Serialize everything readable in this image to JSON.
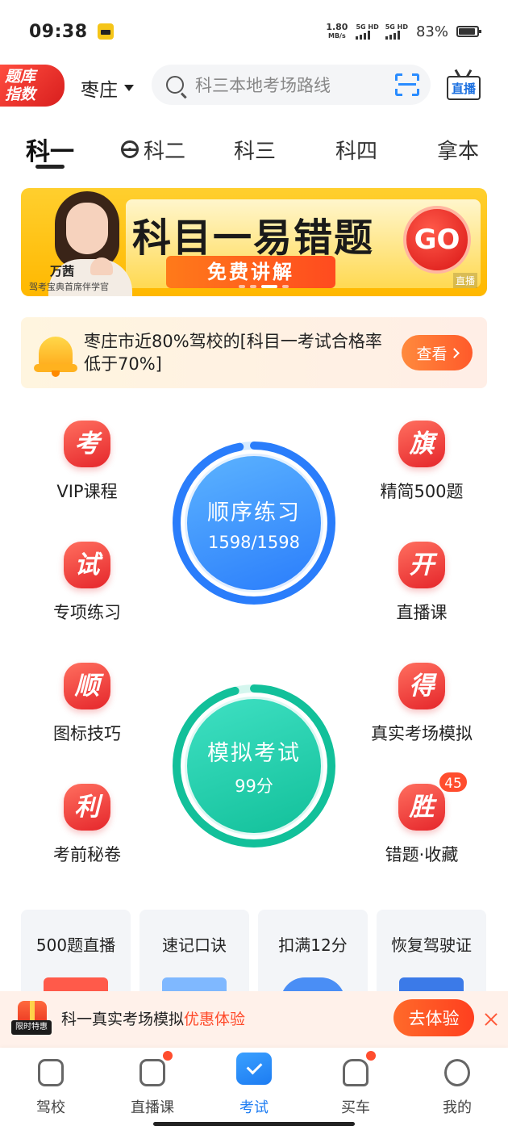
{
  "status_bar": {
    "time": "09:38",
    "net_speed_value": "1.80",
    "net_speed_unit": "MB/s",
    "sim1_label": "5G HD",
    "sim2_label": "5G HD",
    "battery_pct": "83%"
  },
  "header": {
    "badge_line1": "题库",
    "badge_line2": "指数",
    "city": "枣庄",
    "search_placeholder": "科三本地考场路线",
    "live_label": "直播"
  },
  "tabs": [
    {
      "label": "科一",
      "active": true
    },
    {
      "label": "科二",
      "active": false
    },
    {
      "label": "科三",
      "active": false
    },
    {
      "label": "科四",
      "active": false
    },
    {
      "label": "拿本",
      "active": false
    }
  ],
  "banner": {
    "title": "科目一易错题",
    "subtitle": "免费讲解",
    "go_label": "GO",
    "teacher_name": "万茜",
    "teacher_title": "驾考宝典首席伴学官",
    "live_tag": "直播"
  },
  "notice": {
    "text": "枣庄市近80%驾校的[科目一考试合格率低于70%]",
    "button": "查看"
  },
  "features_left": [
    {
      "icon_char": "考",
      "label": "VIP课程"
    },
    {
      "icon_char": "试",
      "label": "专项练习"
    },
    {
      "icon_char": "顺",
      "label": "图标技巧"
    },
    {
      "icon_char": "利",
      "label": "考前秘卷"
    }
  ],
  "features_right": [
    {
      "icon_char": "旗",
      "label": "精简500题"
    },
    {
      "icon_char": "开",
      "label": "直播课"
    },
    {
      "icon_char": "得",
      "label": "真实考场模拟"
    },
    {
      "icon_char": "胜",
      "label": "错题·收藏",
      "badge": "45"
    }
  ],
  "practice": {
    "title": "顺序练习",
    "value": "1598/1598",
    "progress": 1.0,
    "color": "#2a7dfb"
  },
  "exam": {
    "title": "模拟考试",
    "value": "99分",
    "progress": 0.99,
    "color": "#12c09a"
  },
  "shortcuts": [
    {
      "label": "500题直播"
    },
    {
      "label": "速记口诀"
    },
    {
      "label": "扣满12分"
    },
    {
      "label": "恢复驾驶证"
    }
  ],
  "promo": {
    "tag": "限时特惠",
    "text_main": "科一真实考场模拟",
    "text_highlight": "优惠体验",
    "button": "去体验"
  },
  "bottom_nav": [
    {
      "label": "驾校",
      "icon": "school-icon",
      "active": false,
      "dot": false
    },
    {
      "label": "直播课",
      "icon": "live-tv-icon",
      "active": false,
      "dot": true
    },
    {
      "label": "考试",
      "icon": "exam-folder-icon",
      "active": true,
      "dot": false
    },
    {
      "label": "买车",
      "icon": "car-icon",
      "active": false,
      "dot": true
    },
    {
      "label": "我的",
      "icon": "profile-smile-icon",
      "active": false,
      "dot": false
    }
  ],
  "colors": {
    "accent_red": "#e5262b",
    "accent_orange": "#ff5a2a",
    "nav_active": "#1d7cf2"
  }
}
